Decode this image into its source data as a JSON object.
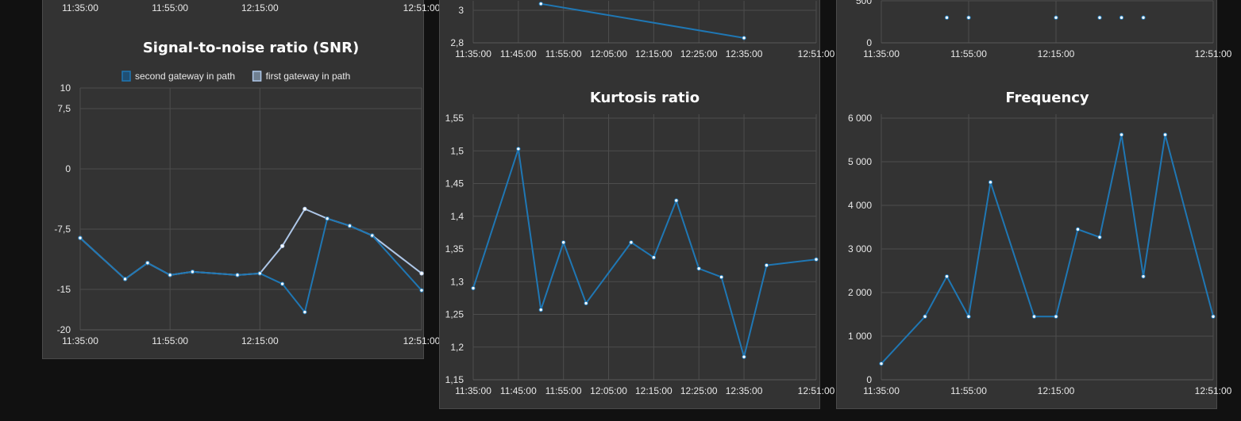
{
  "colors": {
    "background": "#111111",
    "panel": "#333333",
    "series_primary": "#1f77b4",
    "series_secondary": "#aec7e8",
    "marker_fill": "#ffffff"
  },
  "chart_data": [
    {
      "id": "partial-top-left",
      "type": "line",
      "title": "",
      "x_tick_labels": [
        "11:35:00",
        "11:55:00",
        "12:15:00",
        "12:51:00"
      ],
      "series": []
    },
    {
      "id": "snr",
      "type": "line",
      "title": "Signal-to-noise ratio (SNR)",
      "legend": {
        "position": "top",
        "entries": [
          "second gateway in path",
          "first gateway in path"
        ]
      },
      "ylim": [
        -20,
        10
      ],
      "y_ticks": [
        {
          "value": 10,
          "label": "10"
        },
        {
          "value": 7.5,
          "label": "7,5"
        },
        {
          "value": 0,
          "label": "0"
        },
        {
          "value": -7.5,
          "label": "-7,5"
        },
        {
          "value": -15,
          "label": "-15"
        },
        {
          "value": -20,
          "label": "-20"
        }
      ],
      "xlim": [
        "11:35:00",
        "12:51:00"
      ],
      "x_ticks": [
        "11:35:00",
        "11:55:00",
        "12:15:00",
        "12:51:00"
      ],
      "grid": true,
      "series": [
        {
          "name": "second gateway in path",
          "color": "#1f77b4",
          "x": [
            "11:35:00",
            "11:45:00",
            "11:50:00",
            "11:55:00",
            "12:00:00",
            "12:10:00",
            "12:15:00",
            "12:20:00",
            "12:25:00",
            "12:30:00",
            "12:35:00",
            "12:40:00",
            "12:51:00"
          ],
          "y": [
            -8.6,
            -13.7,
            -11.7,
            -13.2,
            -12.8,
            -13.2,
            -13,
            -14.3,
            -17.8,
            -6.2,
            -7.1,
            -8.3,
            -15.1
          ]
        },
        {
          "name": "first gateway in path",
          "color": "#aec7e8",
          "x": [
            "11:35:00",
            "11:45:00",
            "11:50:00",
            "11:55:00",
            "12:00:00",
            "12:10:00",
            "12:15:00",
            "12:20:00",
            "12:25:00",
            "12:30:00",
            "12:35:00",
            "12:40:00",
            "12:51:00"
          ],
          "y": [
            -8.6,
            -13.7,
            -11.7,
            -13.2,
            -12.8,
            -13.2,
            -13,
            -9.6,
            -5,
            -6.2,
            -7.1,
            -8.3,
            -13
          ]
        }
      ]
    },
    {
      "id": "partial-top-middle",
      "type": "line",
      "title": "",
      "ylim": [
        2.8,
        3
      ],
      "y_ticks": [
        {
          "value": 3,
          "label": "3"
        },
        {
          "value": 2.8,
          "label": "2,8"
        }
      ],
      "xlim": [
        "11:35:00",
        "12:51:00"
      ],
      "x_ticks": [
        "11:35:00",
        "11:45:00",
        "11:55:00",
        "12:05:00",
        "12:15:00",
        "12:25:00",
        "12:35:00",
        "12:51:00"
      ],
      "grid": true,
      "series": [
        {
          "color": "#1f77b4",
          "x": [
            "11:50:00",
            "12:35:00"
          ],
          "y": [
            3.04,
            2.83
          ]
        }
      ]
    },
    {
      "id": "kurtosis",
      "type": "line",
      "title": "Kurtosis ratio",
      "ylim": [
        1.15,
        1.55
      ],
      "y_ticks": [
        {
          "value": 1.55,
          "label": "1,55"
        },
        {
          "value": 1.5,
          "label": "1,5"
        },
        {
          "value": 1.45,
          "label": "1,45"
        },
        {
          "value": 1.4,
          "label": "1,4"
        },
        {
          "value": 1.35,
          "label": "1,35"
        },
        {
          "value": 1.3,
          "label": "1,3"
        },
        {
          "value": 1.25,
          "label": "1,25"
        },
        {
          "value": 1.2,
          "label": "1,2"
        },
        {
          "value": 1.15,
          "label": "1,15"
        }
      ],
      "xlim": [
        "11:35:00",
        "12:51:00"
      ],
      "x_ticks": [
        "11:35:00",
        "11:45:00",
        "11:55:00",
        "12:05:00",
        "12:15:00",
        "12:25:00",
        "12:35:00",
        "12:51:00"
      ],
      "grid": true,
      "series": [
        {
          "color": "#1f77b4",
          "x": [
            "11:35:00",
            "11:45:00",
            "11:50:00",
            "11:55:00",
            "12:00:00",
            "12:10:00",
            "12:15:00",
            "12:20:00",
            "12:25:00",
            "12:30:00",
            "12:35:00",
            "12:40:00",
            "12:51:00"
          ],
          "y": [
            1.29,
            1.503,
            1.257,
            1.36,
            1.267,
            1.36,
            1.337,
            1.424,
            1.32,
            1.307,
            1.185,
            1.325,
            1.334
          ]
        }
      ]
    },
    {
      "id": "partial-top-right",
      "type": "scatter",
      "title": "",
      "y_ticks": [
        {
          "value": 500,
          "label": "500"
        },
        {
          "value": 0,
          "label": "0"
        }
      ],
      "xlim": [
        "11:35:00",
        "12:51:00"
      ],
      "x_ticks": [
        "11:35:00",
        "11:55:00",
        "12:15:00",
        "12:51:00"
      ],
      "grid": true,
      "series": [
        {
          "color": "#1f77b4",
          "x": [
            "11:50:00",
            "11:55:00",
            "12:15:00",
            "12:25:00",
            "12:30:00",
            "12:35:00"
          ],
          "y": [
            300,
            300,
            300,
            300,
            300,
            300
          ]
        }
      ]
    },
    {
      "id": "frequency",
      "type": "line",
      "title": "Frequency",
      "ylim": [
        0,
        6000
      ],
      "y_ticks": [
        {
          "value": 6000,
          "label": "6 000"
        },
        {
          "value": 5000,
          "label": "5 000"
        },
        {
          "value": 4000,
          "label": "4 000"
        },
        {
          "value": 3000,
          "label": "3 000"
        },
        {
          "value": 2000,
          "label": "2 000"
        },
        {
          "value": 1000,
          "label": "1 000"
        },
        {
          "value": 0,
          "label": "0"
        }
      ],
      "xlim": [
        "11:35:00",
        "12:51:00"
      ],
      "x_ticks": [
        "11:35:00",
        "11:55:00",
        "12:15:00",
        "12:51:00"
      ],
      "grid": true,
      "series": [
        {
          "color": "#1f77b4",
          "x": [
            "11:35:00",
            "11:45:00",
            "11:50:00",
            "11:55:00",
            "12:00:00",
            "12:10:00",
            "12:15:00",
            "12:20:00",
            "12:25:00",
            "12:30:00",
            "12:35:00",
            "12:40:00",
            "12:51:00"
          ],
          "y": [
            370,
            1450,
            2370,
            1450,
            4530,
            1450,
            1450,
            3450,
            3270,
            5620,
            2370,
            5620,
            1450
          ]
        }
      ]
    }
  ]
}
